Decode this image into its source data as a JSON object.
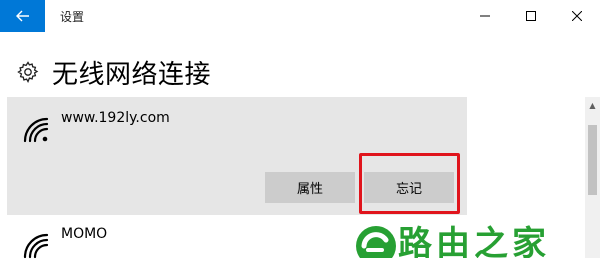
{
  "window": {
    "title": "设置"
  },
  "page": {
    "title": "无线网络连接"
  },
  "networks": [
    {
      "name": "www.192ly.com",
      "selected": true
    },
    {
      "name": "MOMO",
      "selected": false
    }
  ],
  "actions": {
    "properties_label": "属性",
    "forget_label": "忘记"
  },
  "watermark": {
    "text": "路由之家"
  },
  "colors": {
    "accent": "#0078d7",
    "selected_bg": "#e6e6e6",
    "button_bg": "#cccccc",
    "highlight": "#e0141c",
    "watermark": "#27a033"
  },
  "icons": {
    "back": "arrow-left-icon",
    "settings": "gear-icon",
    "network": "wifi-icon",
    "minimize": "minimize-icon",
    "maximize": "maximize-icon",
    "close": "close-icon"
  }
}
